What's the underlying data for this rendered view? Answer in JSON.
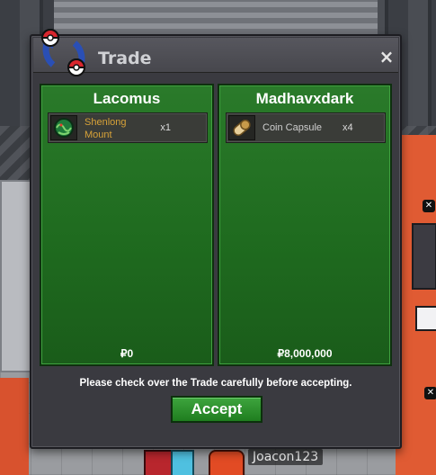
{
  "window": {
    "title": "Trade",
    "close_glyph": "×",
    "logo_icon": "pokeball-exchange-icon"
  },
  "left_panel": {
    "player": "Lacomus",
    "items": [
      {
        "name": "Shenlong Mount",
        "name_line1": "Shenlong",
        "name_line2": "Mount",
        "quantity": "x1",
        "icon": "shenlong-dragon-icon"
      }
    ],
    "money": "₽0"
  },
  "right_panel": {
    "player": "Madhavxdark",
    "items": [
      {
        "name": "Coin Capsule",
        "quantity": "x4",
        "icon": "coin-capsule-icon"
      }
    ],
    "money": "₽8,000,000"
  },
  "notice": "Please check over the Trade carefully before accepting.",
  "accept_label": "Accept",
  "world": {
    "player_name": "Joacon123"
  },
  "colors": {
    "panel_green": "#1f6b1f",
    "item_name_orange": "#d7a238",
    "accept_green": "#2e8f2e"
  }
}
